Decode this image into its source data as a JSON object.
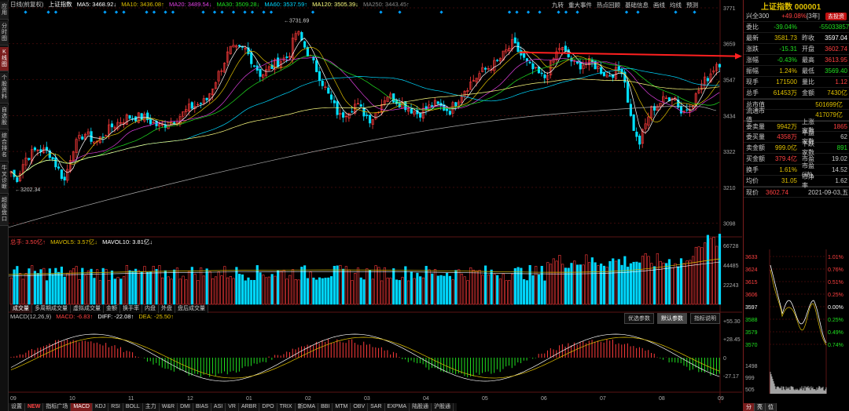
{
  "left_tabs": [
    "应用",
    "分时图",
    "K线图",
    "个股资料",
    "自选股",
    "综合排名",
    "牛叉诊断",
    "超级盘口"
  ],
  "legend": {
    "period": "日线(前复权)",
    "name": "上证指数",
    "ma5": "MA5: 3468.92↓",
    "ma10": "MA10: 3436.08↑",
    "ma20": "MA20: 3489.54↓",
    "ma30": "MA30: 3509.28↓",
    "ma60": "MA60: 3537.59↑",
    "ma120": "MA120: 3505.39↓",
    "ma250": "MA250: 3443.45↑"
  },
  "toolbar": [
    "九转",
    "重大事件",
    "热点回顾",
    "基础信息",
    "画线",
    "均线",
    "预测"
  ],
  "price_axis": [
    "3771",
    "3659",
    "3547",
    "3434",
    "3322",
    "3210",
    "3098"
  ],
  "high_label": "3731.69",
  "low_label": "3202.34",
  "vol_legend": {
    "total": "总手: 3.50亿↑",
    "mavol5": "MAVOL5: 3.57亿↓",
    "mavol10": "MAVOL10: 3.81亿↓"
  },
  "vol_axis": [
    "66728",
    "44485",
    "22243"
  ],
  "vol_tabs": [
    "成交量",
    "多周期成交量",
    "虚拟成交量",
    "金额",
    "换手率",
    "内盘",
    "外盘",
    "盘后成交量"
  ],
  "macd_legend": {
    "name": "MACD(12,26,9)",
    "macd": "MACD: -6.83↑",
    "diff": "DIFF: -22.08↑",
    "dea": "DEA: -25.50↑"
  },
  "macd_buttons": [
    "优选参数",
    "默认参数",
    "指标说明"
  ],
  "macd_axis": [
    "+55.30",
    "+28.45",
    "0",
    "-27.17"
  ],
  "months": [
    "09",
    "10",
    "11",
    "12",
    "01",
    "02",
    "03",
    "04",
    "05",
    "06",
    "07",
    "08",
    "09"
  ],
  "bottom_tabs": [
    "设置",
    "NEW",
    "指标广场",
    "MACD",
    "KDJ",
    "RSI",
    "BOLL",
    "主力",
    "W&R",
    "DMI",
    "BIAS",
    "ASI",
    "VR",
    "ARBR",
    "DPO",
    "TRIX",
    "新DMA",
    "BBI",
    "MTM",
    "OBV",
    "SAR",
    "EXPMA",
    "陆股通",
    "沪股通"
  ],
  "right": {
    "title": "上证指数 000001",
    "top": {
      "label": "兴全300",
      "change": "+49.08%",
      "period": "[3年]",
      "btn": "去投资"
    },
    "rows": [
      {
        "k": "委比",
        "v": "-39.04%",
        "k2": "",
        "v2": "-55033857"
      },
      {
        "k": "最新",
        "v": "3581.73",
        "k2": "昨收",
        "v2": "3597.04"
      },
      {
        "k": "涨跌",
        "v": "-15.31",
        "k2": "开盘",
        "v2": "3602.74"
      },
      {
        "k": "涨幅",
        "v": "-0.43%",
        "k2": "最高",
        "v2": "3613.95"
      },
      {
        "k": "振幅",
        "v": "1.24%",
        "k2": "最低",
        "v2": "3569.40"
      },
      {
        "k": "现手",
        "v": "171500",
        "k2": "量比",
        "v2": "1.12"
      },
      {
        "k": "总手",
        "v": "61453万",
        "k2": "金额",
        "v2": "7430亿"
      },
      {
        "k": "总市值",
        "v": "",
        "k2": "",
        "v2": "501699亿"
      },
      {
        "k": "流通市值",
        "v": "",
        "k2": "",
        "v2": "417079亿"
      },
      {
        "k": "委卖量",
        "v": "9942万",
        "k2": "上涨家数",
        "v2": "1865"
      },
      {
        "k": "委买量",
        "v": "4358万",
        "k2": "平盘家数",
        "v2": "62"
      },
      {
        "k": "卖金额",
        "v": "999.0亿",
        "k2": "下跌家数",
        "v2": "891"
      },
      {
        "k": "买金额",
        "v": "379.4亿",
        "k2": "市盈",
        "v2": "19.02"
      },
      {
        "k": "换手",
        "v": "1.61%",
        "k2": "市盈(动)",
        "v2": "14.52"
      },
      {
        "k": "均价",
        "v": "31.05",
        "k2": "市净率",
        "v2": "1.62"
      }
    ],
    "now": {
      "label": "现价",
      "price": "3602.74",
      "date": "2021-09-03,五"
    },
    "mini_left": [
      "3633",
      "3624",
      "3615",
      "3606",
      "3597",
      "3588",
      "3579",
      "3570"
    ],
    "mini_right": [
      "1.01%",
      "0.76%",
      "0.51%",
      "0.25%",
      "0.00%",
      "0.25%",
      "0.49%",
      "0.74%"
    ],
    "mini_vol": [
      "1498",
      "999",
      "505"
    ],
    "mini_tabs": [
      "分",
      "亮",
      "位"
    ]
  }
}
